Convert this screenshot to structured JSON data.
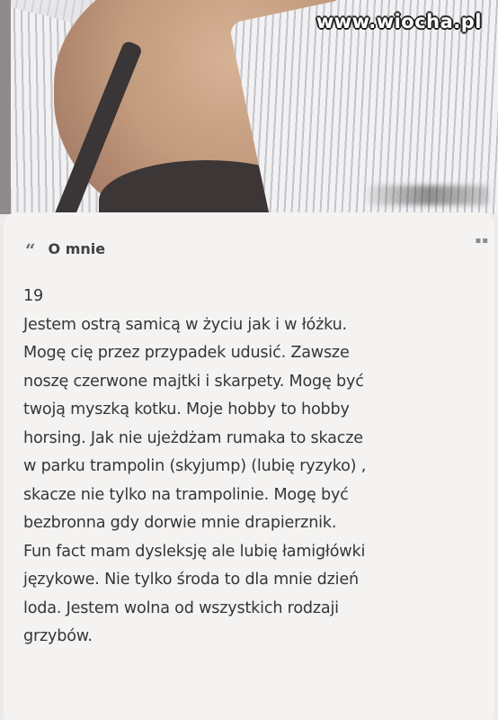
{
  "photo": {
    "watermark": "www.wiocha.pl"
  },
  "about": {
    "title": "O mnie",
    "quote_glyph": "“",
    "more_glyph": "▪▪",
    "lines": [
      "19",
      "Jestem ostrą samicą w życiu jak i w łóżku.",
      "Mogę cię przez przypadek udusić. Zawsze",
      "noszę czerwone majtki i skarpety. Mogę być",
      "twoją myszką kotku. Moje hobby to hobby",
      "horsing. Jak nie ujeżdżam rumaka to skacze",
      "w parku trampolin (skyjump) (lubię ryzyko) ,",
      "skacze nie tylko na trampolinie. Mogę być",
      "bezbronna gdy dorwie mnie drapierznik.",
      "Fun fact mam dysleksję ale lubię łamigłówki",
      "językowe. Nie tylko środa to dla mnie dzień",
      "loda. Jestem wolna od wszystkich rodzaji",
      "grzybów."
    ]
  }
}
